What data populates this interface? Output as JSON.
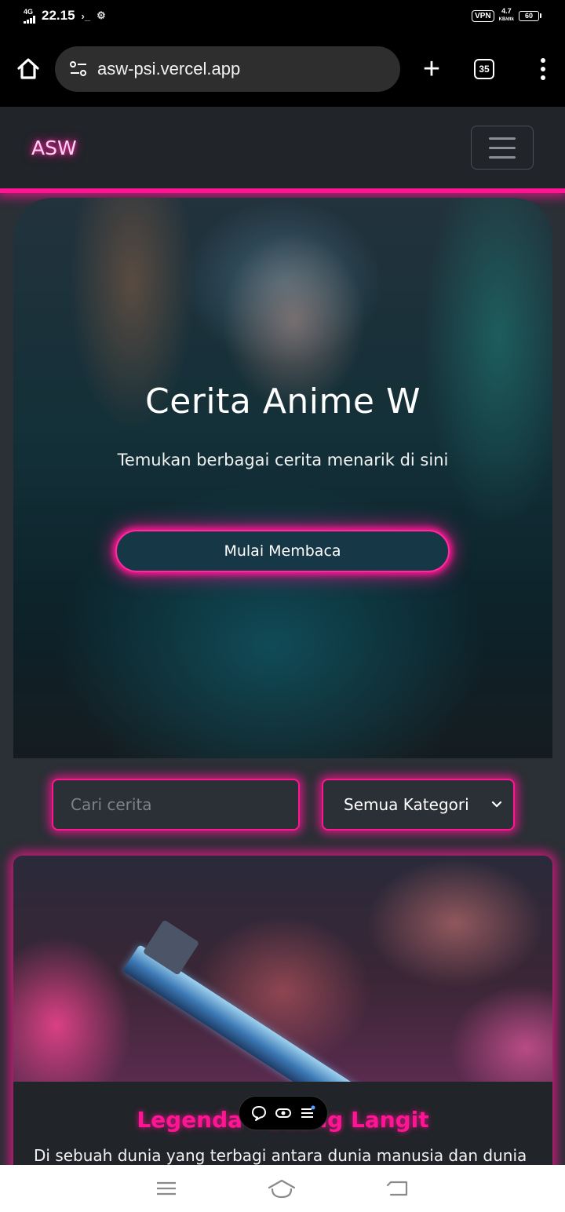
{
  "status_bar": {
    "network": "4G",
    "time": "22.15",
    "vpn": "VPN",
    "speed_value": "4.7",
    "speed_unit": "KB/dtk",
    "battery": "60"
  },
  "browser": {
    "url": "asw-psi.vercel.app",
    "tab_count": "35",
    "new_tab_label": "+"
  },
  "site": {
    "brand": "ASW"
  },
  "hero": {
    "title": "Cerita Anime W",
    "subtitle": "Temukan berbagai cerita menarik di sini",
    "cta_label": "Mulai Membaca"
  },
  "search": {
    "placeholder": "Cari cerita",
    "category_selected": "Semua Kategori"
  },
  "story": {
    "title": "Legenda Pedang Langit",
    "excerpt": "Di sebuah dunia yang terbagi antara dunia manusia dan dunia"
  },
  "colors": {
    "accent": "#ff1493",
    "page_bg": "#2b2f36",
    "nav_bg": "#212429"
  },
  "icons": {
    "home": "home-icon",
    "site_settings": "tune-icon",
    "tabs": "tabs-icon",
    "more": "more-vert-icon",
    "menu_toggle": "hamburger-icon",
    "chevron": "chevron-down-icon",
    "chat": "chat-bubble-icon",
    "eye": "eye-icon",
    "list": "list-icon"
  }
}
